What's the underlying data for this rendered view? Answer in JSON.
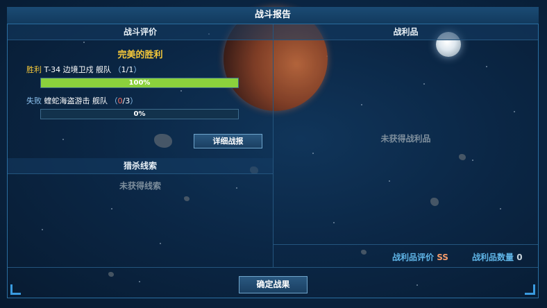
{
  "window": {
    "title": "战斗报告"
  },
  "evaluation": {
    "header": "战斗评价",
    "result_title": "完美的胜利",
    "fleets": [
      {
        "status": "胜利",
        "name": "T-34 边境卫戍 舰队",
        "count_current": "1",
        "count_total": "1",
        "progress": 1.0,
        "progress_label": "100%"
      },
      {
        "status": "失败",
        "name": "蝰蛇海盗游击 舰队",
        "count_current": "0",
        "count_total": "3",
        "progress": 0.0,
        "progress_label": "0%"
      }
    ],
    "detail_button": "详细战报"
  },
  "clues": {
    "header": "猎杀线索",
    "empty": "未获得线索"
  },
  "loot": {
    "header": "战利品",
    "empty": "未获得战利品",
    "rating_label": "战利品评价",
    "rating_value": "SS",
    "count_label": "战利品数量",
    "count_value": "0"
  },
  "confirm_button": "确定战果",
  "colors": {
    "accent": "#f6c93a",
    "progress_fill": "#8bd13c",
    "frame": "#2a6ea0",
    "rating": "#f59b6a"
  }
}
